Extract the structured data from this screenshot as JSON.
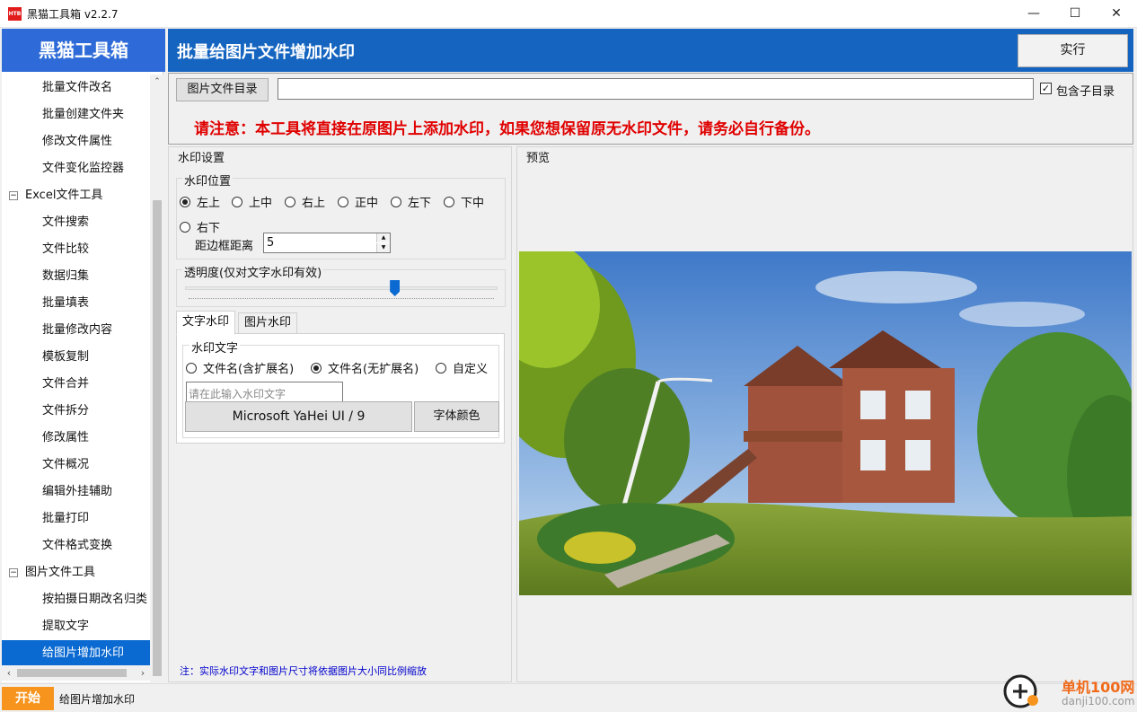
{
  "window": {
    "logo_text": "HTB",
    "title": "黑猫工具箱 v2.2.7",
    "minimize": "—",
    "maximize": "☐",
    "close": "✕"
  },
  "sidebar": {
    "brand": "黑猫工具箱",
    "items": [
      {
        "label": "批量文件改名",
        "type": "item"
      },
      {
        "label": "批量创建文件夹",
        "type": "item"
      },
      {
        "label": "修改文件属性",
        "type": "item"
      },
      {
        "label": "文件变化监控器",
        "type": "item"
      },
      {
        "label": "Excel文件工具",
        "type": "group",
        "expander": "−"
      },
      {
        "label": "文件搜索",
        "type": "item"
      },
      {
        "label": "文件比较",
        "type": "item"
      },
      {
        "label": "数据归集",
        "type": "item"
      },
      {
        "label": "批量填表",
        "type": "item"
      },
      {
        "label": "批量修改内容",
        "type": "item"
      },
      {
        "label": "模板复制",
        "type": "item"
      },
      {
        "label": "文件合并",
        "type": "item"
      },
      {
        "label": "文件拆分",
        "type": "item"
      },
      {
        "label": "修改属性",
        "type": "item"
      },
      {
        "label": "文件概况",
        "type": "item"
      },
      {
        "label": "编辑外挂辅助",
        "type": "item"
      },
      {
        "label": "批量打印",
        "type": "item"
      },
      {
        "label": "文件格式变换",
        "type": "item"
      },
      {
        "label": "图片文件工具",
        "type": "group",
        "expander": "−"
      },
      {
        "label": "按拍摄日期改名归类",
        "type": "item"
      },
      {
        "label": "提取文字",
        "type": "item"
      },
      {
        "label": "给图片增加水印",
        "type": "item",
        "selected": true
      }
    ],
    "scroll_up": "⌃",
    "scroll_down": "⌄",
    "scroll_left": "‹",
    "scroll_right": "›"
  },
  "header": {
    "title": "批量给图片文件增加水印",
    "run_label": "实行"
  },
  "directory": {
    "button_label": "图片文件目录",
    "path_value": "",
    "include_subdirs_label": "包含子目录",
    "include_subdirs_checked": true,
    "check_mark": "✓",
    "warning": "请注意：本工具将直接在原图片上添加水印，如果您想保留原无水印文件，请务必自行备份。"
  },
  "settings": {
    "title": "水印设置",
    "position": {
      "title": "水印位置",
      "options": [
        "左上",
        "上中",
        "右上",
        "正中",
        "左下",
        "下中",
        "右下"
      ],
      "selected": "左上",
      "margin_label": "距边框距离",
      "margin_value": "5",
      "spin_up": "▲",
      "spin_down": "▼"
    },
    "opacity": {
      "title": "透明度(仅对文字水印有效)",
      "value_fraction": 0.67
    },
    "tabs": [
      {
        "label": "文字水印",
        "active": true
      },
      {
        "label": "图片水印",
        "active": false
      }
    ],
    "text_watermark": {
      "title": "水印文字",
      "options": [
        "文件名(含扩展名)",
        "文件名(无扩展名)",
        "自定义"
      ],
      "selected": "文件名(无扩展名)",
      "input_value": "",
      "input_placeholder": "请在此输入水印文字",
      "font_button": "Microsoft YaHei UI / 9",
      "color_button": "字体颜色"
    },
    "note": "注：实际水印文字和图片尺寸将依据图片大小同比例缩放"
  },
  "preview": {
    "title": "预览"
  },
  "statusbar": {
    "start_label": "开始",
    "status_text": "给图片增加水印"
  },
  "site_watermark": {
    "name": "单机100网",
    "url": "danji100.com"
  }
}
